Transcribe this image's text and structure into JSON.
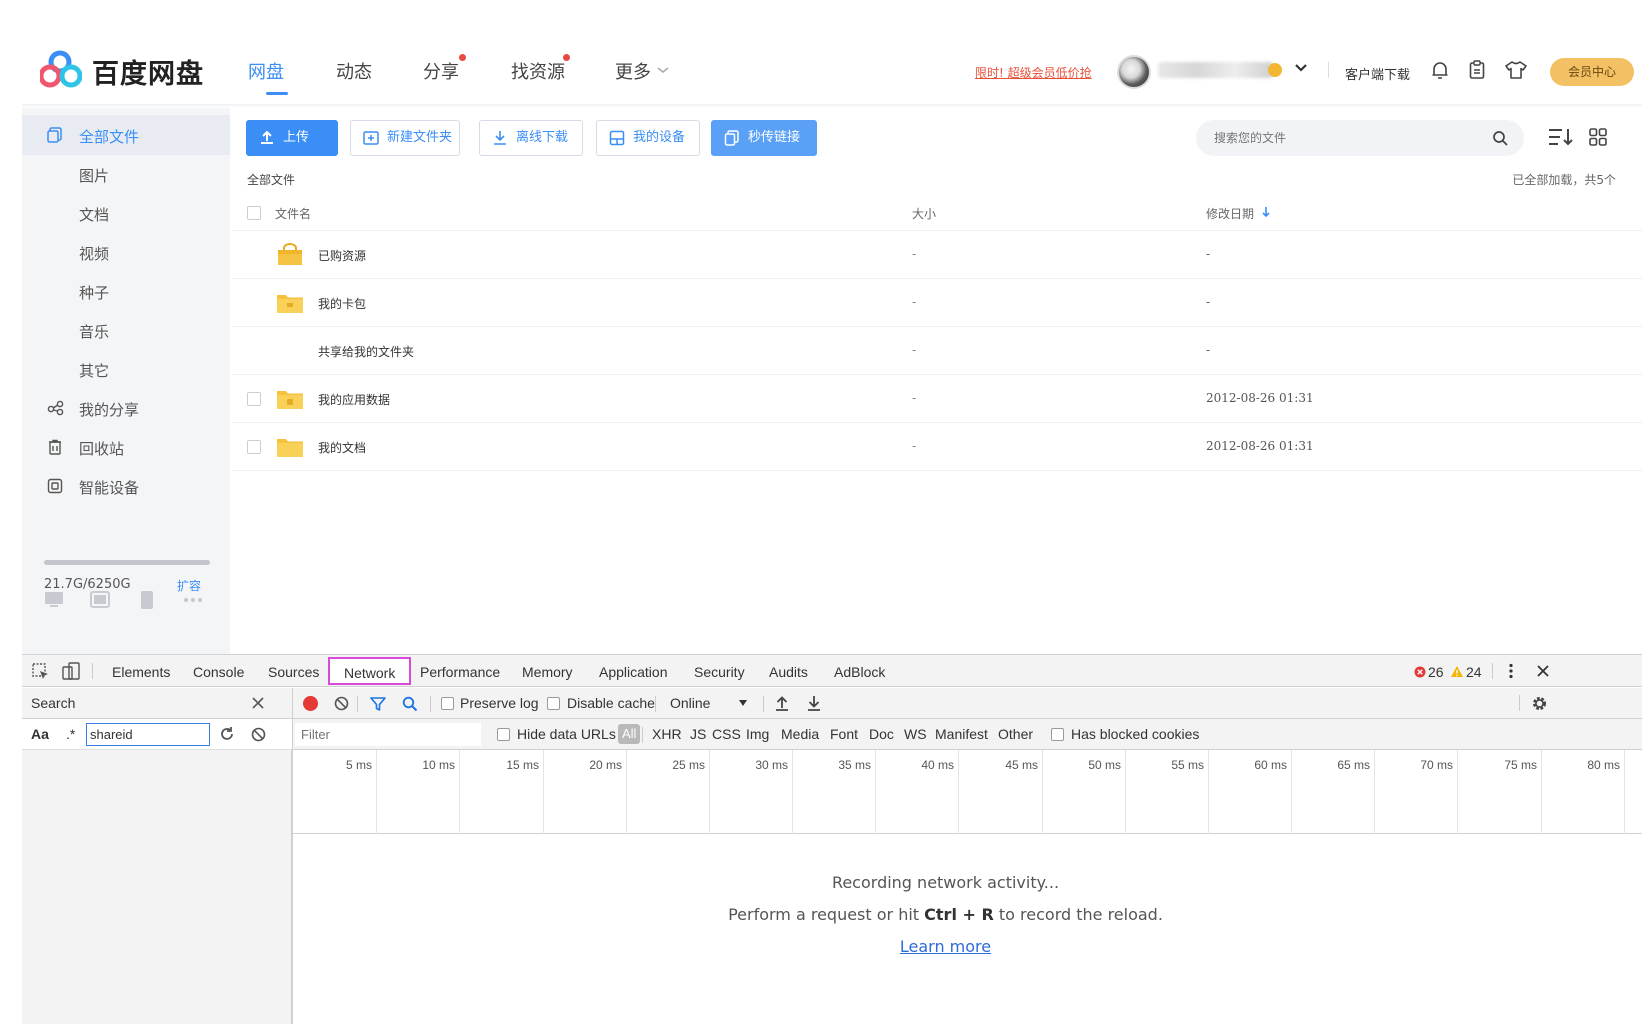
{
  "header": {
    "logo_text": "百度网盘",
    "nav": [
      {
        "label": "网盘",
        "active": true,
        "dot": false
      },
      {
        "label": "动态",
        "active": false,
        "dot": false
      },
      {
        "label": "分享",
        "active": false,
        "dot": true
      },
      {
        "label": "找资源",
        "active": false,
        "dot": true
      },
      {
        "label": "更多",
        "active": false,
        "dot": false
      }
    ],
    "promo_text": "限时! 超级会员低价抢",
    "client_download": "客户端下载",
    "vip_center": "会员中心",
    "icons": [
      "chevron-down-icon",
      "bell-icon",
      "clipboard-icon",
      "shirt-icon"
    ],
    "accent_color": "#3a8ef5"
  },
  "sidebar": {
    "items": [
      {
        "label": "全部文件",
        "icon": "all-files-icon",
        "active": true
      },
      {
        "label": "图片",
        "icon": "",
        "active": false
      },
      {
        "label": "文档",
        "icon": "",
        "active": false
      },
      {
        "label": "视频",
        "icon": "",
        "active": false
      },
      {
        "label": "种子",
        "icon": "",
        "active": false
      },
      {
        "label": "音乐",
        "icon": "",
        "active": false
      },
      {
        "label": "其它",
        "icon": "",
        "active": false
      },
      {
        "label": "我的分享",
        "icon": "share-icon",
        "active": false
      },
      {
        "label": "回收站",
        "icon": "trash-icon",
        "active": false
      },
      {
        "label": "智能设备",
        "icon": "smart-device-icon",
        "active": false
      }
    ],
    "quota_text": "21.7G/6250G",
    "quota_fraction": 0.0035,
    "expand_label": "扩容"
  },
  "toolbar": {
    "upload": "上传",
    "new_folder": "新建文件夹",
    "offline_download": "离线下载",
    "my_devices": "我的设备",
    "instant_link": "秒传链接",
    "search_placeholder": "搜索您的文件"
  },
  "files": {
    "breadcrumb": "全部文件",
    "loaded_status": "已全部加载，共5个",
    "columns": {
      "name": "文件名",
      "size": "大小",
      "date": "修改日期"
    },
    "rows": [
      {
        "name": "已购资源",
        "size": "-",
        "date": "-",
        "icon": "purchased-folder-icon",
        "checkbox": false
      },
      {
        "name": "我的卡包",
        "size": "-",
        "date": "-",
        "icon": "card-folder-icon",
        "checkbox": false
      },
      {
        "name": "共享给我的文件夹",
        "size": "-",
        "date": "-",
        "icon": "",
        "checkbox": false
      },
      {
        "name": "我的应用数据",
        "size": "-",
        "date": "2012-08-26 01:31",
        "icon": "app-folder-icon",
        "checkbox": true
      },
      {
        "name": "我的文档",
        "size": "-",
        "date": "2012-08-26 01:31",
        "icon": "folder-icon",
        "checkbox": true
      }
    ]
  },
  "devtools": {
    "tabs": [
      "Elements",
      "Console",
      "Sources",
      "Network",
      "Performance",
      "Memory",
      "Application",
      "Security",
      "Audits",
      "AdBlock"
    ],
    "active_tab": "Network",
    "error_count": "26",
    "warning_count": "24",
    "search_title": "Search",
    "search_case": "Aa",
    "search_regex": ".*",
    "search_value": "shareid",
    "preserve_log": "Preserve log",
    "disable_cache": "Disable cache",
    "throttle": "Online",
    "filter_placeholder": "Filter",
    "hide_data_urls": "Hide data URLs",
    "filter_types": [
      "All",
      "XHR",
      "JS",
      "CSS",
      "Img",
      "Media",
      "Font",
      "Doc",
      "WS",
      "Manifest",
      "Other"
    ],
    "has_blocked_cookies": "Has blocked cookies",
    "timeline_ticks": [
      "5 ms",
      "10 ms",
      "15 ms",
      "20 ms",
      "25 ms",
      "30 ms",
      "35 ms",
      "40 ms",
      "45 ms",
      "50 ms",
      "55 ms",
      "60 ms",
      "65 ms",
      "70 ms",
      "75 ms",
      "80 ms"
    ],
    "empty_line1": "Recording network activity...",
    "empty_line2_pre": "Perform a request or hit ",
    "empty_line2_key": "Ctrl + R",
    "empty_line2_post": " to record the reload.",
    "learn_more": "Learn more",
    "highlight_color": "#d84bd8"
  }
}
